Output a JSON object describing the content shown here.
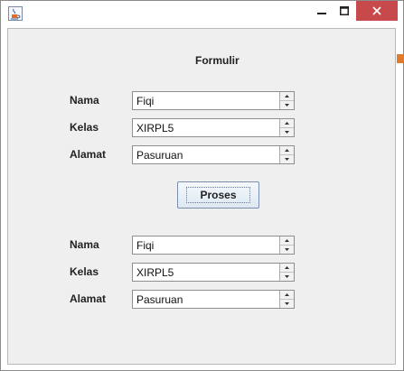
{
  "window": {
    "icon": "java-cup-icon",
    "controls": [
      "minimize-icon",
      "maximize-icon",
      "close-icon"
    ]
  },
  "form": {
    "title": "Formulir",
    "inputs": [
      {
        "label": "Nama",
        "value": "Fiqi"
      },
      {
        "label": "Kelas",
        "value": "XIRPL5"
      },
      {
        "label": "Alamat",
        "value": "Pasuruan"
      }
    ],
    "button_label": "Proses",
    "outputs": [
      {
        "label": "Nama",
        "value": "Fiqi"
      },
      {
        "label": "Kelas",
        "value": "XIRPL5"
      },
      {
        "label": "Alamat",
        "value": "Pasuruan"
      }
    ]
  },
  "colors": {
    "close_button": "#c7494b",
    "panel_background": "#efefef"
  }
}
